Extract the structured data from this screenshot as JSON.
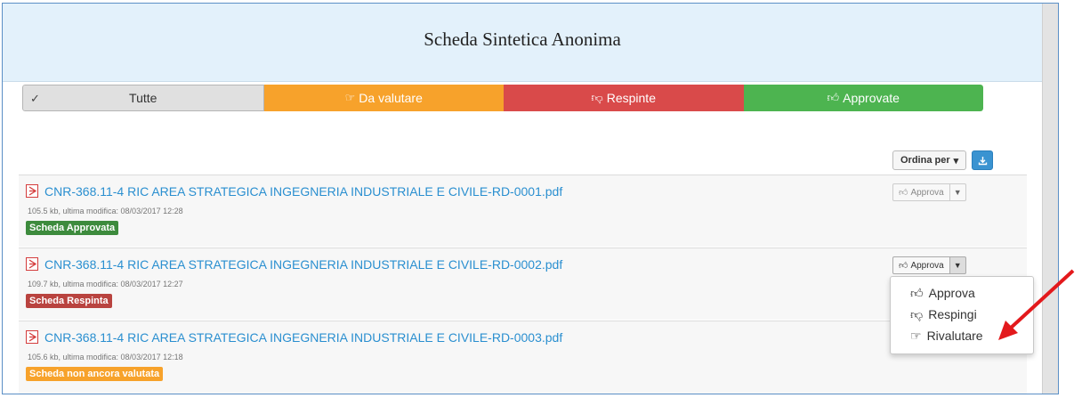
{
  "header": {
    "title": "Scheda Sintetica Anonima"
  },
  "filters": {
    "all": {
      "label": "Tutte",
      "check": "✓"
    },
    "to_evaluate": {
      "label": "Da valutare",
      "icon": "hand-point-right-icon"
    },
    "rejected": {
      "label": "Respinte",
      "icon": "thumbs-down-icon"
    },
    "approved": {
      "label": "Approvate",
      "icon": "thumbs-up-icon"
    }
  },
  "toolbar": {
    "sort_label": "Ordina per",
    "download_icon": "download-icon"
  },
  "documents": [
    {
      "name": "CNR-368.11-4 RIC AREA STRATEGICA INGEGNERIA INDUSTRIALE E CIVILE-RD-0001.pdf",
      "meta": "105.5 kb, ultima modifica: 08/03/2017 12:28",
      "status": "Scheda Approvata",
      "action": "Approva"
    },
    {
      "name": "CNR-368.11-4 RIC AREA STRATEGICA INGEGNERIA INDUSTRIALE E CIVILE-RD-0002.pdf",
      "meta": "109.7 kb, ultima modifica: 08/03/2017 12:27",
      "status": "Scheda Respinta",
      "action": "Approva"
    },
    {
      "name": "CNR-368.11-4 RIC AREA STRATEGICA INGEGNERIA INDUSTRIALE E CIVILE-RD-0003.pdf",
      "meta": "105.6 kb, ultima modifica: 08/03/2017 12:18",
      "status": "Scheda non ancora valutata"
    }
  ],
  "dropdown": {
    "approve": "Approva",
    "reject": "Respingi",
    "reevaluate": "Rivalutare"
  },
  "colors": {
    "header_bg": "#e3f1fb",
    "to_evaluate": "#f7a22b",
    "rejected": "#d94a4a",
    "approved": "#4db450",
    "link": "#2a8fd0",
    "annotation_arrow": "#e3191c"
  }
}
